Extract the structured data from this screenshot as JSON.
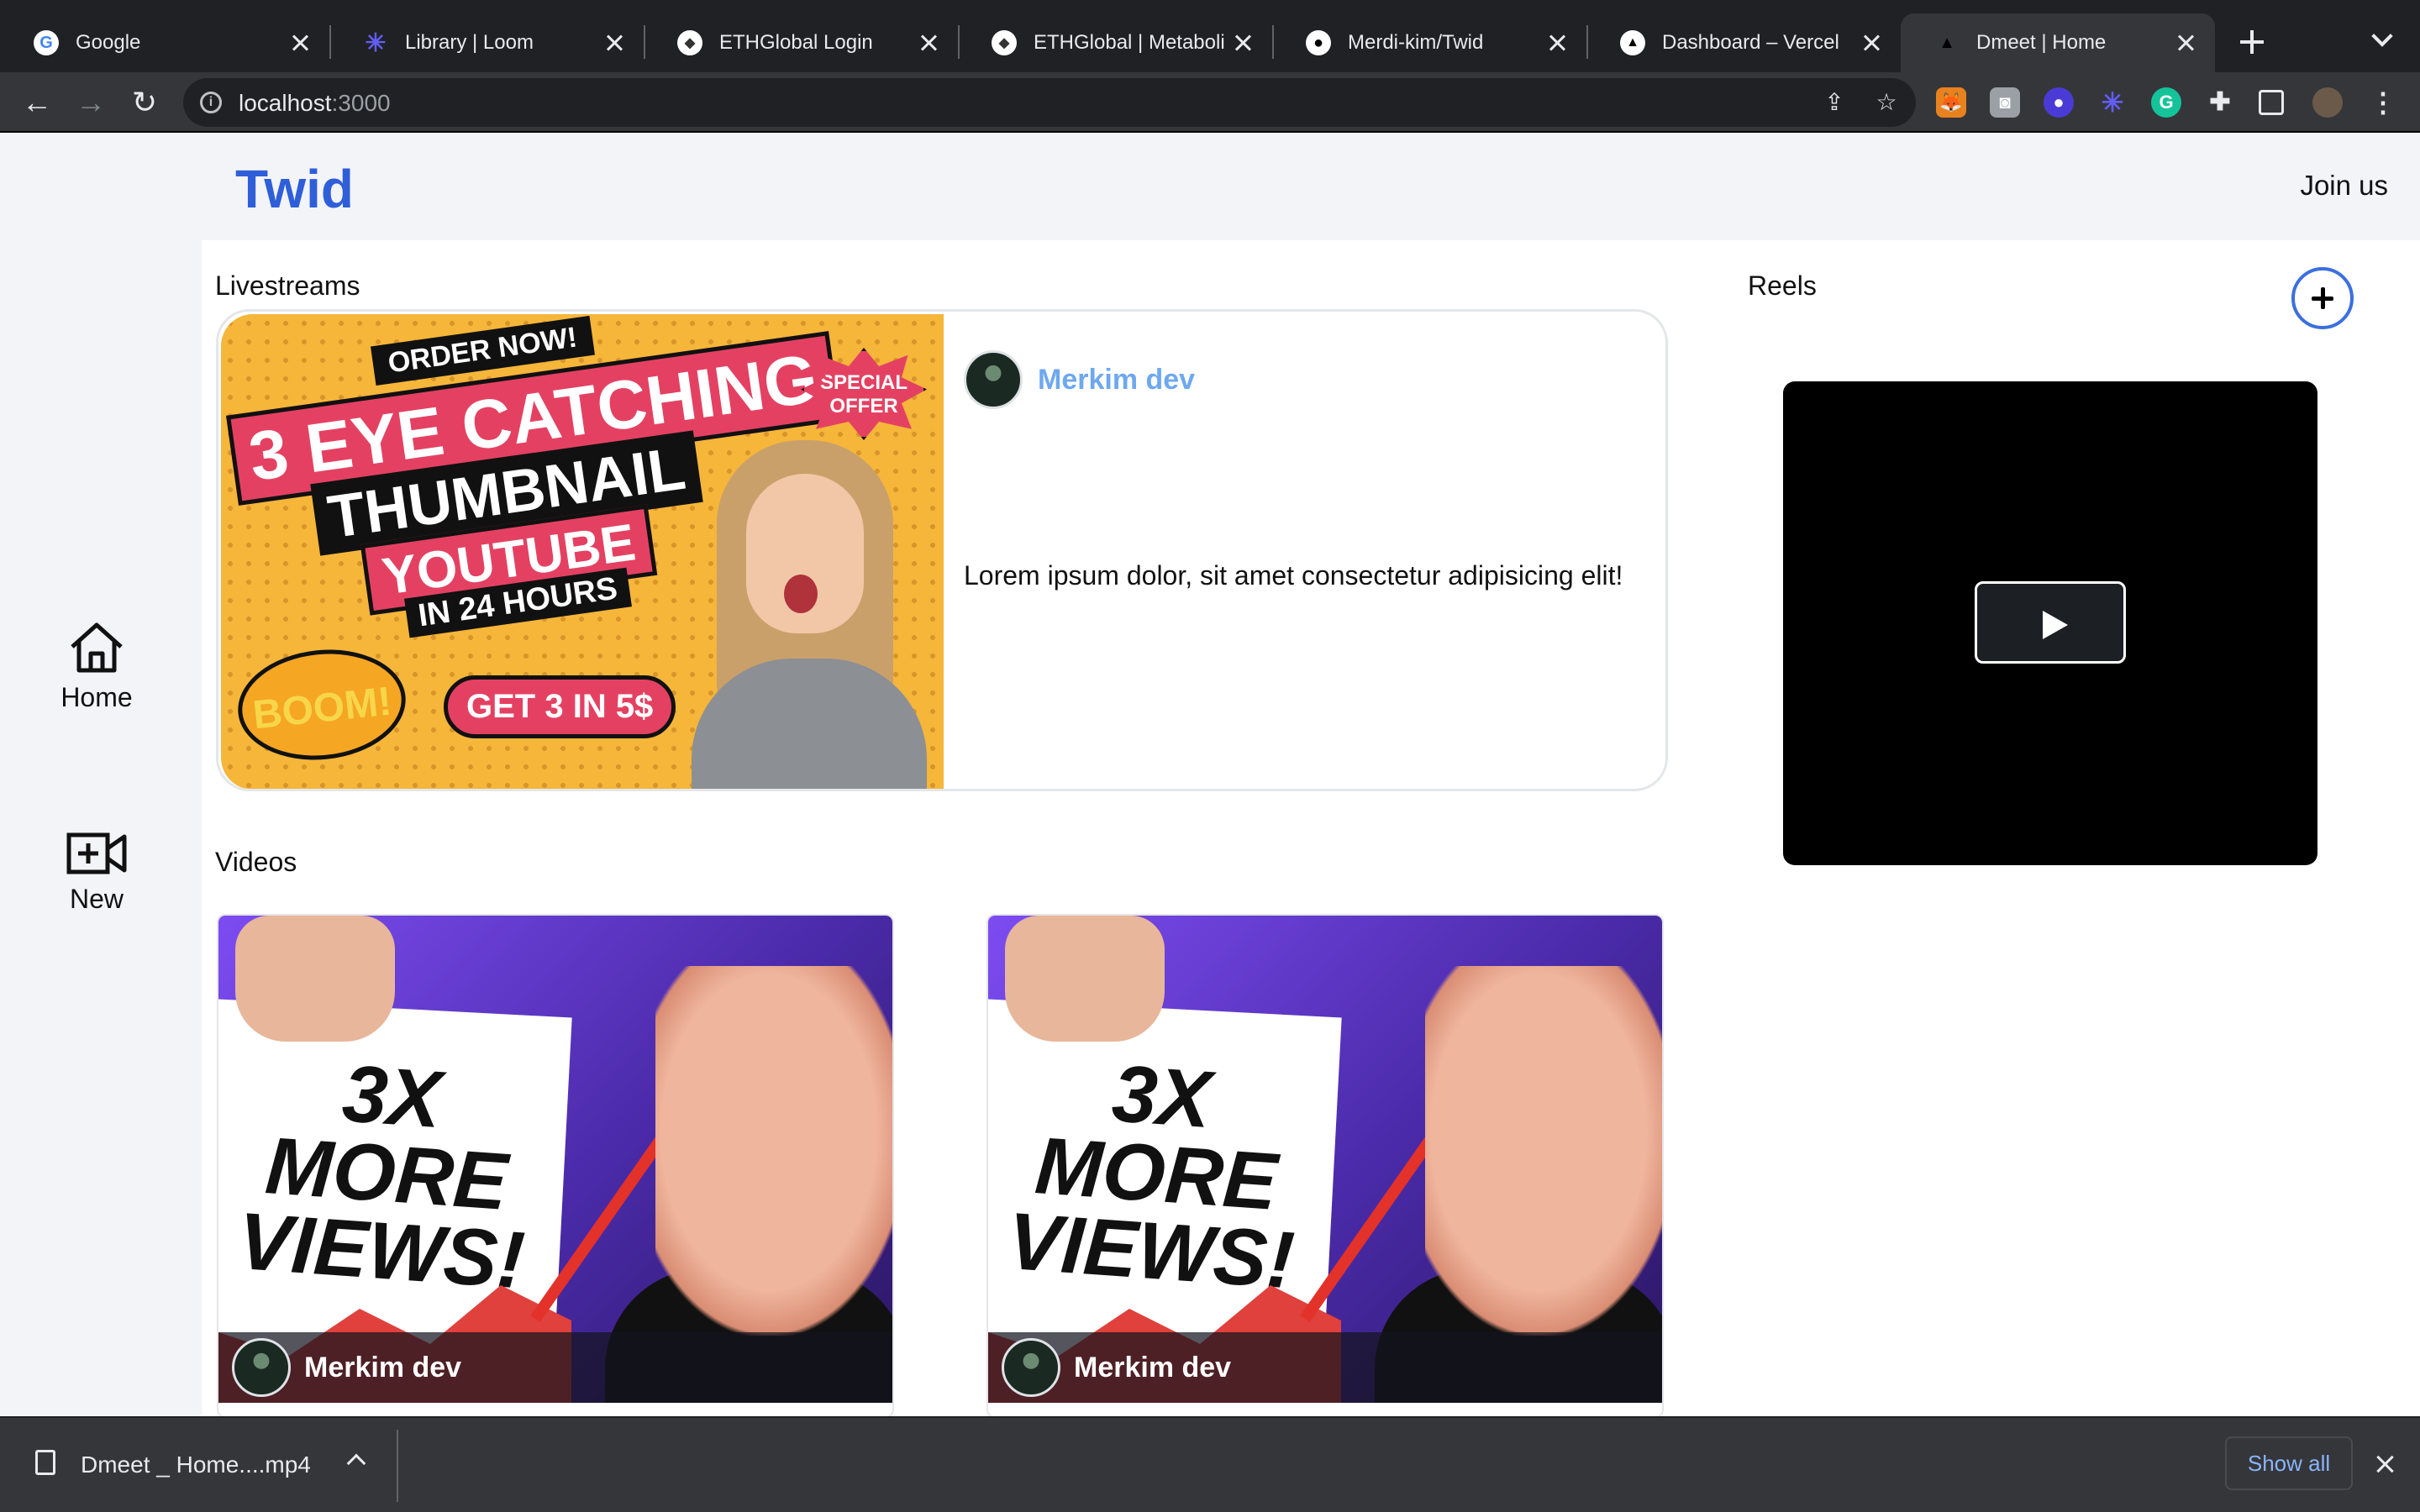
{
  "browser": {
    "tabs": [
      {
        "title": "Google",
        "icon": "google-icon",
        "color": "#ffffff"
      },
      {
        "title": "Library | Loom",
        "icon": "loom-icon",
        "color": "#625df5"
      },
      {
        "title": "ETHGlobal Login",
        "icon": "ethglobal-icon",
        "color": "#ffffff"
      },
      {
        "title": "ETHGlobal | Metabolis",
        "icon": "ethglobal-icon",
        "color": "#ffffff"
      },
      {
        "title": "Merdi-kim/Twid",
        "icon": "github-icon",
        "color": "#ffffff"
      },
      {
        "title": "Dashboard – Vercel",
        "icon": "vercel-icon",
        "color": "#000000"
      },
      {
        "title": "Dmeet | Home",
        "icon": "vercel-icon",
        "color": "#000000"
      }
    ],
    "url_host": "localhost",
    "url_port": ":3000"
  },
  "header": {
    "logo": "Twid",
    "join": "Join us"
  },
  "sidebar": {
    "home": "Home",
    "new": "New"
  },
  "livestreams": {
    "title": "Livestreams",
    "author": "Merkim dev",
    "description": "Lorem ipsum dolor, sit amet consectetur adipisicing elit!",
    "thumbnail": {
      "order": "ORDER NOW!",
      "line1": "3 EYE CATCHING",
      "line2": "THUMBNAIL",
      "line3": "YOUTUBE",
      "line4": "IN 24 HOURS",
      "special": "SPECIAL OFFER",
      "boom": "BOOM!",
      "get": "GET 3 IN 5$"
    }
  },
  "reels": {
    "title": "Reels"
  },
  "videos": {
    "title": "Videos",
    "items": [
      {
        "author": "Merkim dev",
        "thumb_line1": "3X MORE",
        "thumb_line2": "VIEWS!"
      },
      {
        "author": "Merkim dev",
        "thumb_line1": "3X MORE",
        "thumb_line2": "VIEWS!"
      }
    ]
  },
  "downloads": {
    "file": "Dmeet _ Home....mp4",
    "show_all": "Show all"
  }
}
